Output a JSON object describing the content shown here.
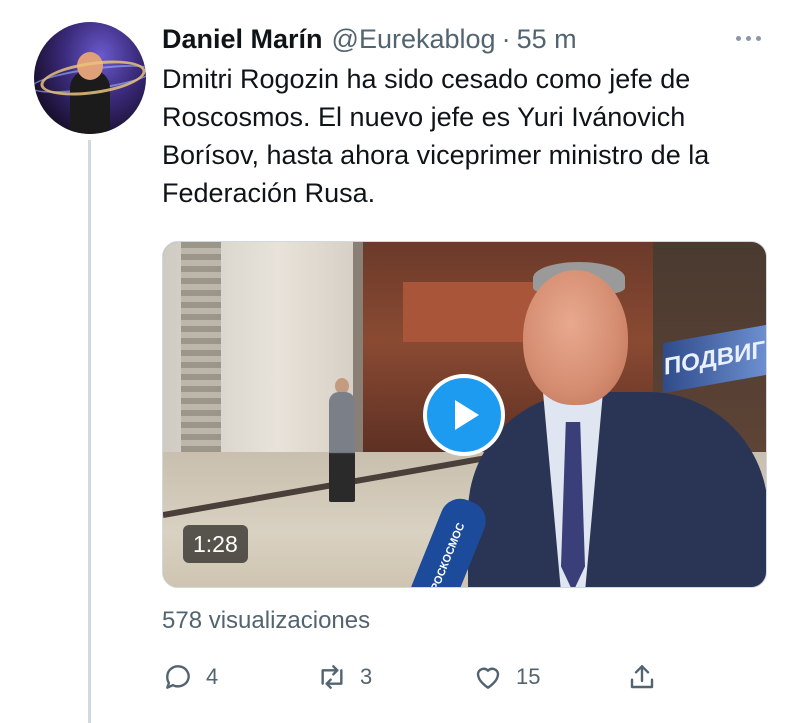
{
  "tweet": {
    "author_name": "Daniel Marín",
    "handle": "@Eurekablog",
    "separator": "·",
    "time": "55 m",
    "text": "Dmitri Rogozin ha sido cesado como jefe de Roscosmos. El nuevo jefe es Yuri Ivánovich Borísov, hasta ahora viceprimer ministro de la Federación Rusa.",
    "media": {
      "duration": "1:28",
      "sign_text": "ПОДВИГ",
      "mic_text": "РОСКОСМОС"
    },
    "views": "578 visualizaciones",
    "actions": {
      "reply_icon": "reply-icon",
      "reply_count": "4",
      "retweet_icon": "retweet-icon",
      "retweet_count": "3",
      "like_icon": "heart-icon",
      "like_count": "15",
      "share_icon": "share-icon"
    }
  },
  "colors": {
    "accent": "#1d9bf0",
    "secondary_text": "#536471",
    "primary_text": "#0f1419",
    "thread_line": "#cfd9de"
  }
}
